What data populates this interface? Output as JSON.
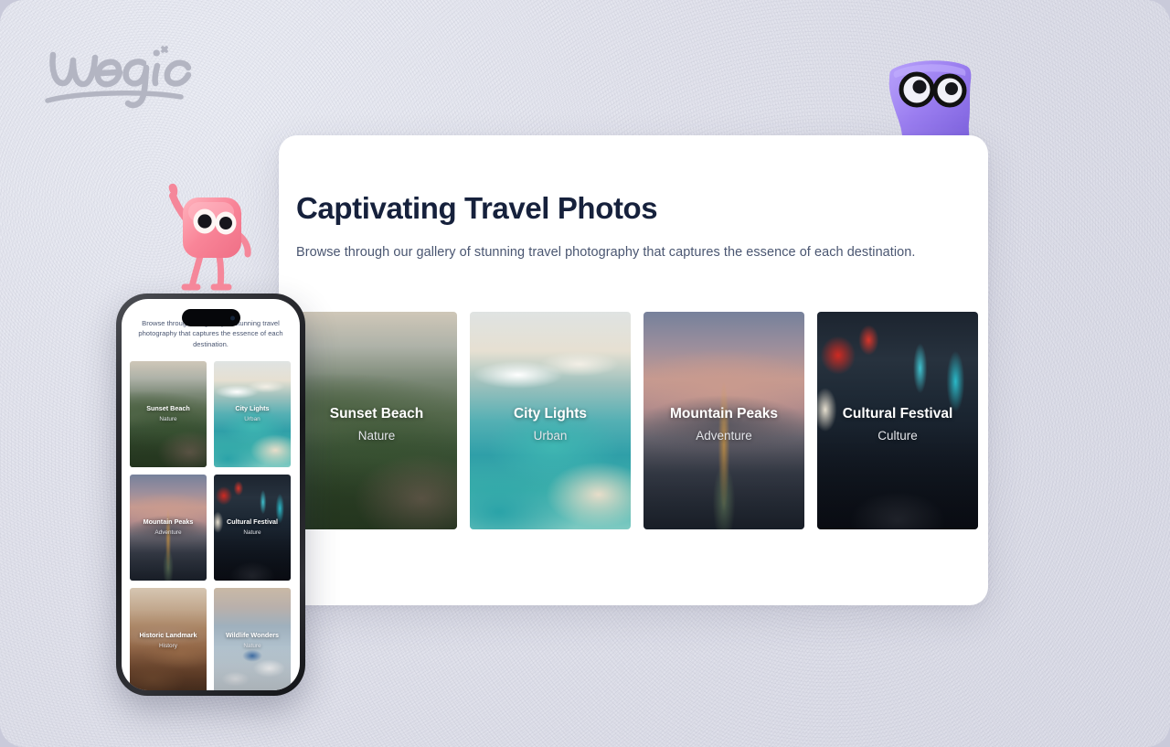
{
  "brand": {
    "name": "wegic",
    "logo_color": "#b3b5c2"
  },
  "mascots": {
    "purple": {
      "name": "purple-glasses-mascot",
      "color": "#9b7ef0"
    },
    "pink": {
      "name": "pink-waving-mascot",
      "color": "#f5879a"
    }
  },
  "panel": {
    "title": "Captivating Travel Photos",
    "subtitle": "Browse through our gallery of stunning travel photography that captures the essence of each destination.",
    "background": "#ffffff",
    "title_color": "#16213c",
    "subtitle_color": "#4a5671"
  },
  "gallery": {
    "cards": [
      {
        "title": "Sunset Beach",
        "category": "Nature",
        "photo": "great-wall-green-mountains"
      },
      {
        "title": "City Lights",
        "category": "Urban",
        "photo": "turquoise-coast-beach"
      },
      {
        "title": "Mountain Peaks",
        "category": "Adventure",
        "photo": "eiffel-tower-dusk"
      },
      {
        "title": "Cultural Festival",
        "category": "Culture",
        "photo": "tokyo-neon-street"
      }
    ]
  },
  "phone": {
    "subtitle": "Browse through our gallery of stunning travel photography that captures the essence of each destination.",
    "cards": [
      {
        "title": "Sunset Beach",
        "category": "Nature",
        "photo": "great-wall-green-mountains"
      },
      {
        "title": "City Lights",
        "category": "Urban",
        "photo": "turquoise-coast-beach"
      },
      {
        "title": "Mountain Peaks",
        "category": "Adventure",
        "photo": "eiffel-tower-dusk"
      },
      {
        "title": "Cultural Festival",
        "category": "Nature",
        "photo": "tokyo-neon-street"
      },
      {
        "title": "Historic Landmark",
        "category": "History",
        "photo": "canyon-landscape"
      },
      {
        "title": "Wildlife Wonders",
        "category": "Nature",
        "photo": "santorini-white-village"
      }
    ]
  }
}
